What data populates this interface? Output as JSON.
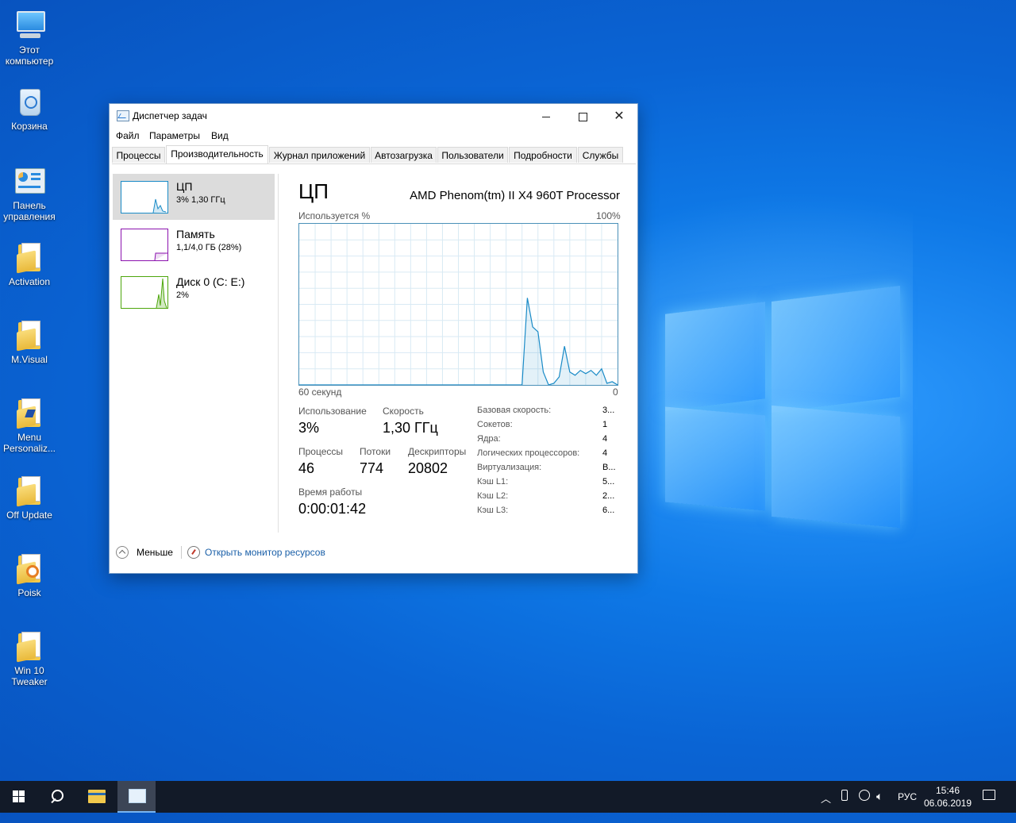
{
  "desktop": {
    "icons": [
      {
        "label_1": "Этот",
        "label_2": "компьютер"
      },
      {
        "label_1": "Корзина",
        "label_2": ""
      },
      {
        "label_1": "Панель",
        "label_2": "управления"
      },
      {
        "label_1": "Activation",
        "label_2": ""
      },
      {
        "label_1": "M.Visual",
        "label_2": ""
      },
      {
        "label_1": "Menu",
        "label_2": "Personaliz..."
      },
      {
        "label_1": "Off Update",
        "label_2": ""
      },
      {
        "label_1": "Poisk",
        "label_2": ""
      },
      {
        "label_1": "Win 10",
        "label_2": "Tweaker"
      }
    ]
  },
  "window": {
    "title": "Диспетчер задач",
    "minimize": "Свернуть",
    "maximize": "Развернуть",
    "close": "Закрыть"
  },
  "menu": {
    "file": "Файл",
    "params": "Параметры",
    "view": "Вид"
  },
  "tabs": [
    "Процессы",
    "Производительность",
    "Журнал приложений",
    "Автозагрузка",
    "Пользователи",
    "Подробности",
    "Службы"
  ],
  "active_tab": "Производительность",
  "sidebar": [
    {
      "name": "ЦП",
      "sub": "3%  1,30 ГГц",
      "color": "#1a8bc7"
    },
    {
      "name": "Память",
      "sub": "1,1/4,0 ГБ (28%)",
      "color": "#8b12ae"
    },
    {
      "name": "Диск 0 (C: E:)",
      "sub": "2%",
      "color": "#4da60c"
    }
  ],
  "cpu": {
    "heading": "ЦП",
    "model": "AMD Phenom(tm) II X4 960T Processor",
    "usage_label": "Используется %",
    "max_label": "100%",
    "time_label": "60 секунд",
    "zero_label": "0",
    "stats": {
      "usage_label": "Использование",
      "usage": "3%",
      "speed_label": "Скорость",
      "speed": "1,30 ГГц",
      "processes_label": "Процессы",
      "processes": "46",
      "threads_label": "Потоки",
      "threads": "774",
      "handles_label": "Дескрипторы",
      "handles": "20802",
      "uptime_label": "Время работы",
      "uptime": "0:00:01:42"
    },
    "specs": [
      {
        "k": "Базовая скорость:",
        "v": "3..."
      },
      {
        "k": "Сокетов:",
        "v": "1"
      },
      {
        "k": "Ядра:",
        "v": "4"
      },
      {
        "k": "Логических процессоров:",
        "v": "4"
      },
      {
        "k": "Виртуализация:",
        "v": "В..."
      },
      {
        "k": "Кэш L1:",
        "v": "5..."
      },
      {
        "k": "Кэш L2:",
        "v": "2..."
      },
      {
        "k": "Кэш L3:",
        "v": "6..."
      }
    ],
    "graph_color": "#1a8bc7"
  },
  "chart_data": {
    "type": "area",
    "x": [
      0,
      5,
      10,
      15,
      20,
      25,
      30,
      35,
      40,
      42,
      43,
      44,
      45,
      46,
      47,
      48,
      49,
      50,
      51,
      52,
      53,
      54,
      55,
      56,
      57,
      58,
      59,
      60
    ],
    "values": [
      0,
      0,
      0,
      0,
      0,
      0,
      0,
      0,
      0,
      0,
      54,
      36,
      33,
      8,
      0,
      1,
      5,
      24,
      8,
      6,
      9,
      7,
      9,
      6,
      10,
      1,
      2,
      0
    ],
    "xlabel": "60 секунд",
    "ylabel": "Используется %",
    "ylim": [
      0,
      100
    ]
  },
  "footer": {
    "less": "Меньше",
    "monitor": "Открыть монитор ресурсов"
  },
  "taskbar": {
    "lang": "РУС",
    "time": "15:46",
    "date": "06.06.2019"
  }
}
